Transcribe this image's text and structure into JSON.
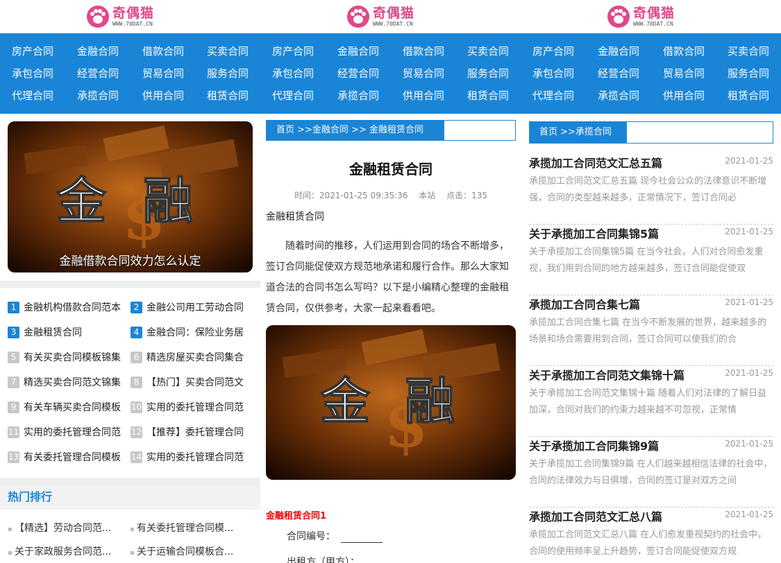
{
  "header": {
    "logos": [
      {
        "text": "奇偶猫",
        "url": "WWW.70DAT.CN"
      },
      {
        "text": "奇偶猫",
        "url": "WWW.70DAT.CN"
      },
      {
        "text": "奇偶猫",
        "url": "WWW.70DAT.CN"
      }
    ]
  },
  "nav": {
    "rows": [
      [
        "房产合同",
        "金融合同",
        "借款合同",
        "买卖合同",
        "房产合同",
        "金融合同",
        "借款合同",
        "买卖合同",
        "房产合同",
        "金融合同",
        "借款合同",
        "买卖合同"
      ],
      [
        "承包合同",
        "经营合同",
        "贸易合同",
        "服务合同",
        "承包合同",
        "经营合同",
        "贸易合同",
        "服务合同",
        "承包合同",
        "经营合同",
        "贸易合同",
        "服务合同"
      ],
      [
        "代理合同",
        "承揽合同",
        "供用合同",
        "租赁合同",
        "代理合同",
        "承揽合同",
        "供用合同",
        "租赁合同",
        "代理合同",
        "承揽合同",
        "供用合同",
        "租赁合同"
      ]
    ]
  },
  "left": {
    "featured_caption": "金融借款合同效力怎么认定",
    "image_text": "金 融",
    "ranking": [
      {
        "num": "1",
        "title": "金融机构借款合同范本"
      },
      {
        "num": "2",
        "title": "金融公司用工劳动合同"
      },
      {
        "num": "3",
        "title": "金融租赁合同"
      },
      {
        "num": "4",
        "title": "金融合同：保险业务居"
      },
      {
        "num": "5",
        "title": "有关买卖合同模板锦集"
      },
      {
        "num": "6",
        "title": "精选房屋买卖合同集合"
      },
      {
        "num": "7",
        "title": "精选买卖合同范文锦集"
      },
      {
        "num": "8",
        "title": "【热门】买卖合同范文"
      },
      {
        "num": "9",
        "title": "有关车辆买卖合同模板"
      },
      {
        "num": "10",
        "title": "实用的委托管理合同范"
      },
      {
        "num": "11",
        "title": "实用的委托管理合同范"
      },
      {
        "num": "12",
        "title": "【推荐】委托管理合同"
      },
      {
        "num": "13",
        "title": "有关委托管理合同模板"
      },
      {
        "num": "14",
        "title": "实用的委托管理合同范"
      }
    ],
    "hot_title": "热门排行",
    "hot": [
      "【精选】劳动合同范...",
      "有关委托管理合同模...",
      "关于家政服务合同范...",
      "关于运输合同模板合..."
    ]
  },
  "center": {
    "breadcrumb": "首页 >>金融合同  >> 金融租赁合同",
    "title": "金融租赁合同",
    "meta": "时间：2021-01-25 09:35:36　 本站　 点击：135",
    "subtitle": "金融租赁合同",
    "paragraph": "随着时间的推移，人们运用到合同的场合不断增多，签订合同能促使双方规范地承诺和履行合作。那么大家知道合法的合同书怎么写吗？以下是小编精心整理的金融租赁合同，仅供参考，大家一起来看看吧。",
    "image_text": "金 融",
    "red_heading": "金融租赁合同1",
    "contract_no_label": "合同编号：",
    "lessor_label": "出租方（甲方）："
  },
  "right": {
    "breadcrumb": "首页 >>承揽合同",
    "articles": [
      {
        "title": "承揽加工合同范文汇总五篇",
        "date": "2021-01-25",
        "summary": "承揽加工合同范文汇总五篇 现今社会公众的法律意识不断增强，合同的类型越来越多，正常情况下，签订合同必"
      },
      {
        "title": "关于承揽加工合同集锦5篇",
        "date": "2021-01-25",
        "summary": "关于承揽加工合同集锦5篇 在当今社会，人们对合同愈发重视，我们用到合同的地方越来越多，签订合同能促使双"
      },
      {
        "title": "承揽加工合同合集七篇",
        "date": "2021-01-25",
        "summary": "承揽加工合同合集七篇 在当今不断发展的世界，越来越多的场景和场合需要用到合同，签订合同可以使我们的合"
      },
      {
        "title": "关于承揽加工合同范文集锦十篇",
        "date": "2021-01-25",
        "summary": "关于承揽加工合同范文集锦十篇 随着人们对法律的了解日益加深，合同对我们的约束力越来越不可忽视，正常情"
      },
      {
        "title": "关于承揽加工合同集锦9篇",
        "date": "2021-01-25",
        "summary": "关于承揽加工合同集锦9篇 在人们越来越相信法律的社会中，合同的法律效力与日俱增，合同的签订是对双方之间"
      },
      {
        "title": "承揽加工合同范文汇总八篇",
        "date": "2021-01-25",
        "summary": "承揽加工合同范文汇总八篇 在人们愈发重视契约的社会中，合同的使用频率呈上升趋势，签订合同能促使双方规"
      }
    ]
  }
}
